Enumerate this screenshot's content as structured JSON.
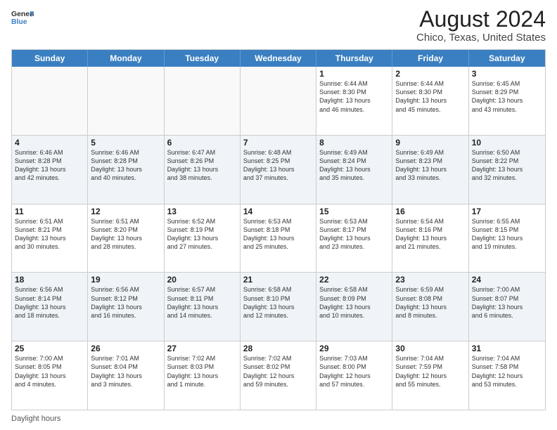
{
  "header": {
    "logo_line1": "General",
    "logo_line2": "Blue",
    "title": "August 2024",
    "subtitle": "Chico, Texas, United States"
  },
  "calendar": {
    "days_of_week": [
      "Sunday",
      "Monday",
      "Tuesday",
      "Wednesday",
      "Thursday",
      "Friday",
      "Saturday"
    ],
    "rows": [
      {
        "alt": false,
        "cells": [
          {
            "day": "",
            "info": ""
          },
          {
            "day": "",
            "info": ""
          },
          {
            "day": "",
            "info": ""
          },
          {
            "day": "",
            "info": ""
          },
          {
            "day": "1",
            "info": "Sunrise: 6:44 AM\nSunset: 8:30 PM\nDaylight: 13 hours\nand 46 minutes."
          },
          {
            "day": "2",
            "info": "Sunrise: 6:44 AM\nSunset: 8:30 PM\nDaylight: 13 hours\nand 45 minutes."
          },
          {
            "day": "3",
            "info": "Sunrise: 6:45 AM\nSunset: 8:29 PM\nDaylight: 13 hours\nand 43 minutes."
          }
        ]
      },
      {
        "alt": true,
        "cells": [
          {
            "day": "4",
            "info": "Sunrise: 6:46 AM\nSunset: 8:28 PM\nDaylight: 13 hours\nand 42 minutes."
          },
          {
            "day": "5",
            "info": "Sunrise: 6:46 AM\nSunset: 8:28 PM\nDaylight: 13 hours\nand 40 minutes."
          },
          {
            "day": "6",
            "info": "Sunrise: 6:47 AM\nSunset: 8:26 PM\nDaylight: 13 hours\nand 38 minutes."
          },
          {
            "day": "7",
            "info": "Sunrise: 6:48 AM\nSunset: 8:25 PM\nDaylight: 13 hours\nand 37 minutes."
          },
          {
            "day": "8",
            "info": "Sunrise: 6:49 AM\nSunset: 8:24 PM\nDaylight: 13 hours\nand 35 minutes."
          },
          {
            "day": "9",
            "info": "Sunrise: 6:49 AM\nSunset: 8:23 PM\nDaylight: 13 hours\nand 33 minutes."
          },
          {
            "day": "10",
            "info": "Sunrise: 6:50 AM\nSunset: 8:22 PM\nDaylight: 13 hours\nand 32 minutes."
          }
        ]
      },
      {
        "alt": false,
        "cells": [
          {
            "day": "11",
            "info": "Sunrise: 6:51 AM\nSunset: 8:21 PM\nDaylight: 13 hours\nand 30 minutes."
          },
          {
            "day": "12",
            "info": "Sunrise: 6:51 AM\nSunset: 8:20 PM\nDaylight: 13 hours\nand 28 minutes."
          },
          {
            "day": "13",
            "info": "Sunrise: 6:52 AM\nSunset: 8:19 PM\nDaylight: 13 hours\nand 27 minutes."
          },
          {
            "day": "14",
            "info": "Sunrise: 6:53 AM\nSunset: 8:18 PM\nDaylight: 13 hours\nand 25 minutes."
          },
          {
            "day": "15",
            "info": "Sunrise: 6:53 AM\nSunset: 8:17 PM\nDaylight: 13 hours\nand 23 minutes."
          },
          {
            "day": "16",
            "info": "Sunrise: 6:54 AM\nSunset: 8:16 PM\nDaylight: 13 hours\nand 21 minutes."
          },
          {
            "day": "17",
            "info": "Sunrise: 6:55 AM\nSunset: 8:15 PM\nDaylight: 13 hours\nand 19 minutes."
          }
        ]
      },
      {
        "alt": true,
        "cells": [
          {
            "day": "18",
            "info": "Sunrise: 6:56 AM\nSunset: 8:14 PM\nDaylight: 13 hours\nand 18 minutes."
          },
          {
            "day": "19",
            "info": "Sunrise: 6:56 AM\nSunset: 8:12 PM\nDaylight: 13 hours\nand 16 minutes."
          },
          {
            "day": "20",
            "info": "Sunrise: 6:57 AM\nSunset: 8:11 PM\nDaylight: 13 hours\nand 14 minutes."
          },
          {
            "day": "21",
            "info": "Sunrise: 6:58 AM\nSunset: 8:10 PM\nDaylight: 13 hours\nand 12 minutes."
          },
          {
            "day": "22",
            "info": "Sunrise: 6:58 AM\nSunset: 8:09 PM\nDaylight: 13 hours\nand 10 minutes."
          },
          {
            "day": "23",
            "info": "Sunrise: 6:59 AM\nSunset: 8:08 PM\nDaylight: 13 hours\nand 8 minutes."
          },
          {
            "day": "24",
            "info": "Sunrise: 7:00 AM\nSunset: 8:07 PM\nDaylight: 13 hours\nand 6 minutes."
          }
        ]
      },
      {
        "alt": false,
        "cells": [
          {
            "day": "25",
            "info": "Sunrise: 7:00 AM\nSunset: 8:05 PM\nDaylight: 13 hours\nand 4 minutes."
          },
          {
            "day": "26",
            "info": "Sunrise: 7:01 AM\nSunset: 8:04 PM\nDaylight: 13 hours\nand 3 minutes."
          },
          {
            "day": "27",
            "info": "Sunrise: 7:02 AM\nSunset: 8:03 PM\nDaylight: 13 hours\nand 1 minute."
          },
          {
            "day": "28",
            "info": "Sunrise: 7:02 AM\nSunset: 8:02 PM\nDaylight: 12 hours\nand 59 minutes."
          },
          {
            "day": "29",
            "info": "Sunrise: 7:03 AM\nSunset: 8:00 PM\nDaylight: 12 hours\nand 57 minutes."
          },
          {
            "day": "30",
            "info": "Sunrise: 7:04 AM\nSunset: 7:59 PM\nDaylight: 12 hours\nand 55 minutes."
          },
          {
            "day": "31",
            "info": "Sunrise: 7:04 AM\nSunset: 7:58 PM\nDaylight: 12 hours\nand 53 minutes."
          }
        ]
      }
    ]
  },
  "footer": {
    "text": "Daylight hours"
  }
}
